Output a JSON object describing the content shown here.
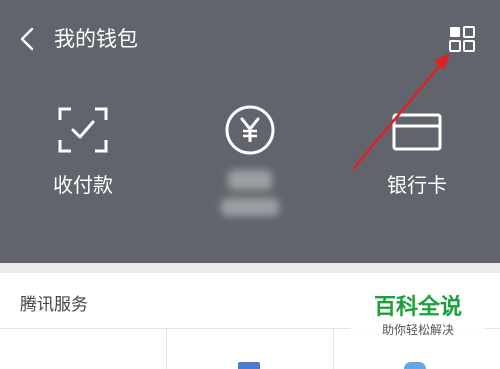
{
  "header": {
    "title": "我的钱包",
    "back_icon": "chevron-left-icon",
    "menu_icon": "grid-menu-icon"
  },
  "actions": [
    {
      "label": "收付款",
      "icon": "scan-check-icon"
    },
    {
      "label": "",
      "icon": "yuan-coin-icon",
      "blurred": true
    },
    {
      "label": "银行卡",
      "icon": "bank-card-icon"
    }
  ],
  "services": {
    "title": "腾讯服务"
  },
  "watermark": {
    "title": "百科全说",
    "subtitle": "助你轻松解决"
  },
  "colors": {
    "header_bg": "#61646c",
    "annotation_arrow": "#e02020",
    "watermark_green": "#19a23a"
  }
}
